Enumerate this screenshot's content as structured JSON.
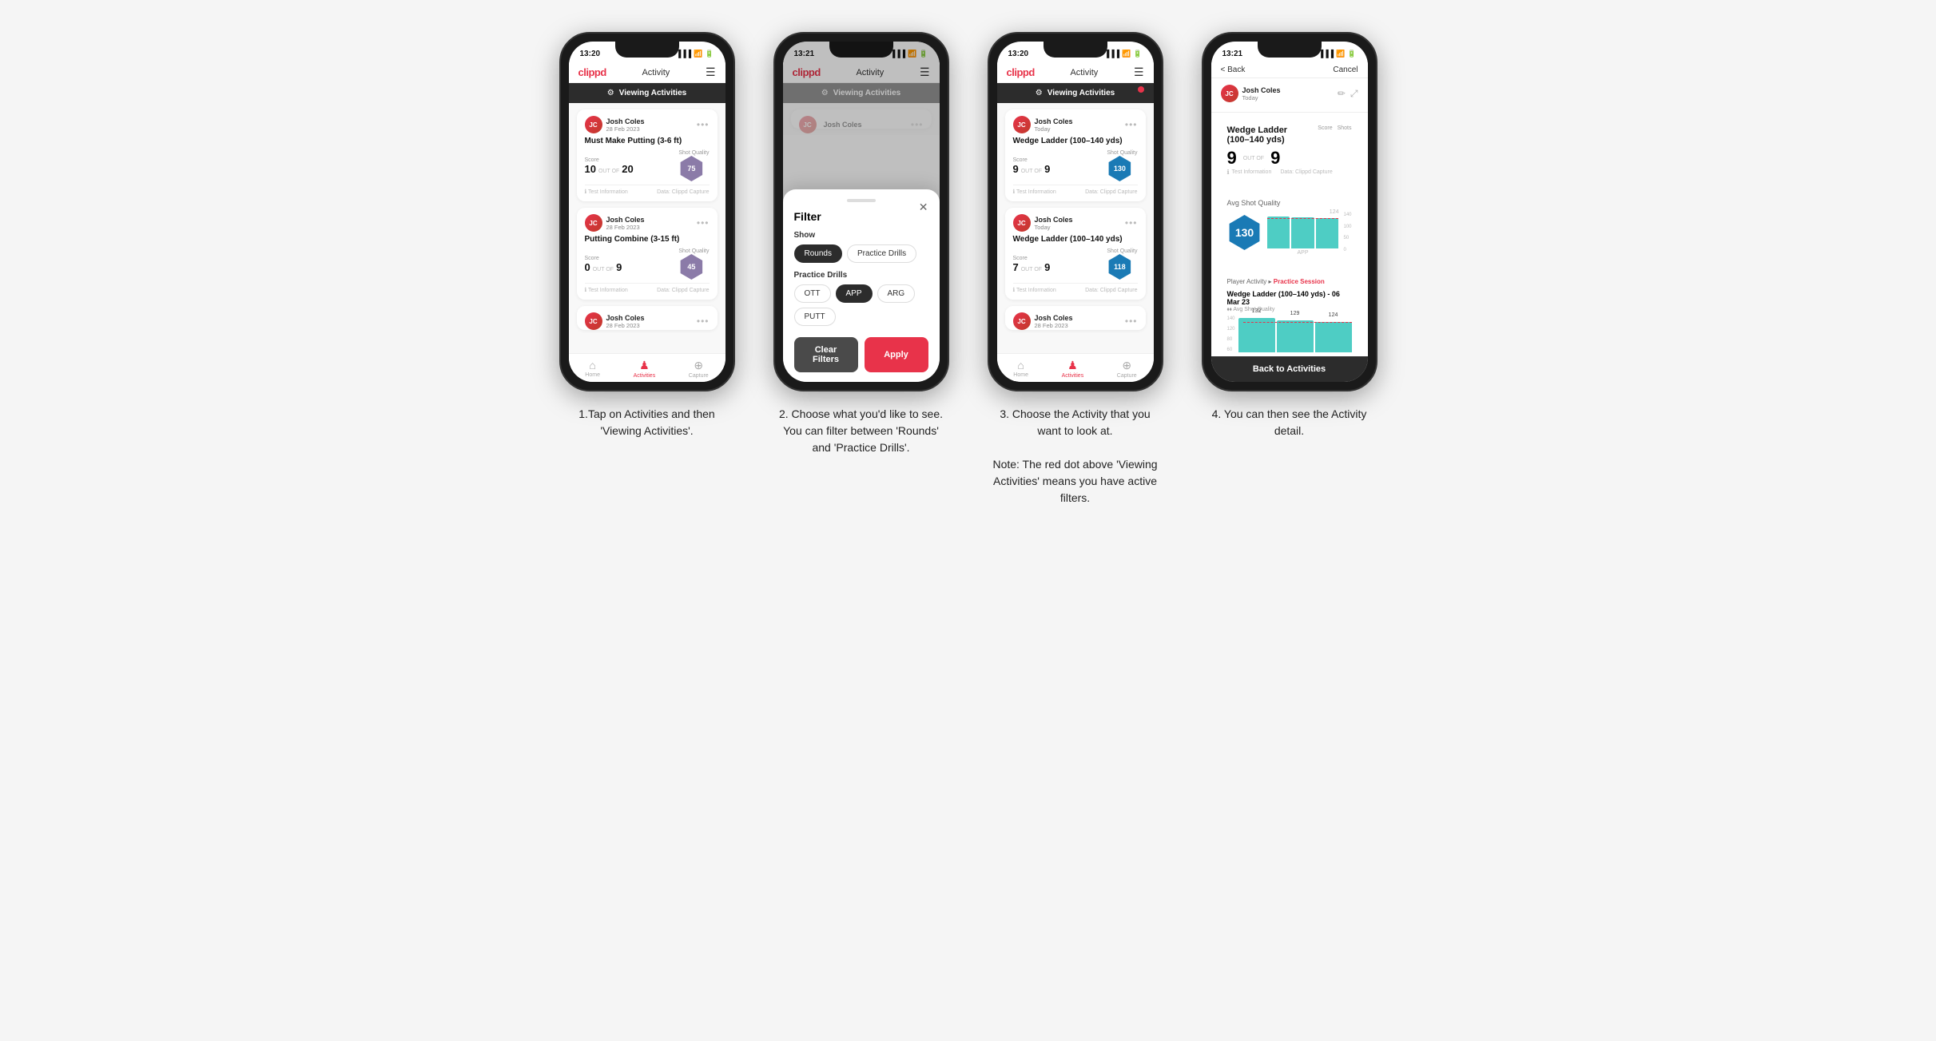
{
  "phones": [
    {
      "id": "phone1",
      "status_time": "13:20",
      "nav_logo": "clippd",
      "nav_title": "Activity",
      "viewing_label": "Viewing Activities",
      "has_red_dot": false,
      "cards": [
        {
          "user_name": "Josh Coles",
          "user_date": "28 Feb 2023",
          "title": "Must Make Putting (3-6 ft)",
          "score": "10",
          "shots": "20",
          "shot_quality": "75",
          "sq_color": "#8B7BA8"
        },
        {
          "user_name": "Josh Coles",
          "user_date": "28 Feb 2023",
          "title": "Putting Combine (3-15 ft)",
          "score": "0",
          "shots": "9",
          "shot_quality": "45",
          "sq_color": "#8B7BA8"
        },
        {
          "user_name": "Josh Coles",
          "user_date": "28 Feb 2023",
          "title": "",
          "score": "",
          "shots": "",
          "shot_quality": "",
          "sq_color": ""
        }
      ],
      "tab_home": "Home",
      "tab_activities": "Activities",
      "tab_capture": "Capture"
    },
    {
      "id": "phone2",
      "status_time": "13:21",
      "nav_logo": "clippd",
      "nav_title": "Activity",
      "viewing_label": "Viewing Activities",
      "filter_title": "Filter",
      "filter_show_label": "Show",
      "filter_rounds_label": "Rounds",
      "filter_drills_label": "Practice Drills",
      "filter_practice_label": "Practice Drills",
      "filter_ott": "OTT",
      "filter_app": "APP",
      "filter_arg": "ARG",
      "filter_putt": "PUTT",
      "btn_clear": "Clear Filters",
      "btn_apply": "Apply"
    },
    {
      "id": "phone3",
      "status_time": "13:20",
      "nav_logo": "clippd",
      "nav_title": "Activity",
      "viewing_label": "Viewing Activities",
      "has_red_dot": true,
      "cards": [
        {
          "user_name": "Josh Coles",
          "user_date": "Today",
          "title": "Wedge Ladder (100–140 yds)",
          "score": "9",
          "shots": "9",
          "shot_quality": "130",
          "sq_color": "#1a7ab5"
        },
        {
          "user_name": "Josh Coles",
          "user_date": "Today",
          "title": "Wedge Ladder (100–140 yds)",
          "score": "7",
          "shots": "9",
          "shot_quality": "118",
          "sq_color": "#1a7ab5"
        },
        {
          "user_name": "Josh Coles",
          "user_date": "28 Feb 2023",
          "title": "",
          "score": "",
          "shots": "",
          "shot_quality": "",
          "sq_color": ""
        }
      ]
    },
    {
      "id": "phone4",
      "status_time": "13:21",
      "back_label": "< Back",
      "cancel_label": "Cancel",
      "user_name": "Josh Coles",
      "user_date": "Today",
      "drill_title": "Wedge Ladder (100–140 yds)",
      "score_label": "Score",
      "shots_label": "Shots",
      "score_value": "9",
      "outof": "OUT OF",
      "shots_value": "9",
      "sq_value": "130",
      "chart_title": "Avg Shot Quality",
      "chart_bars": [
        132,
        129,
        124
      ],
      "chart_bar_color": "#4ecdc4",
      "chart_ref_line": 124,
      "chart_line_value": "124",
      "y_labels": [
        "140",
        "100",
        "50",
        "0"
      ],
      "session_label": "Player Activity",
      "session_type": "Practice Session",
      "drill_label_2": "Wedge Ladder (100–140 yds) - 06 Mar 23",
      "chart_title_2": "Avg Shot Quality",
      "back_to_label": "Back to Activities"
    }
  ],
  "captions": [
    "1.Tap on Activities and then 'Viewing Activities'.",
    "2. Choose what you'd like to see. You can filter between 'Rounds' and 'Practice Drills'.",
    "3. Choose the Activity that you want to look at.\n\nNote: The red dot above 'Viewing Activities' means you have active filters.",
    "4. You can then see the Activity detail."
  ]
}
